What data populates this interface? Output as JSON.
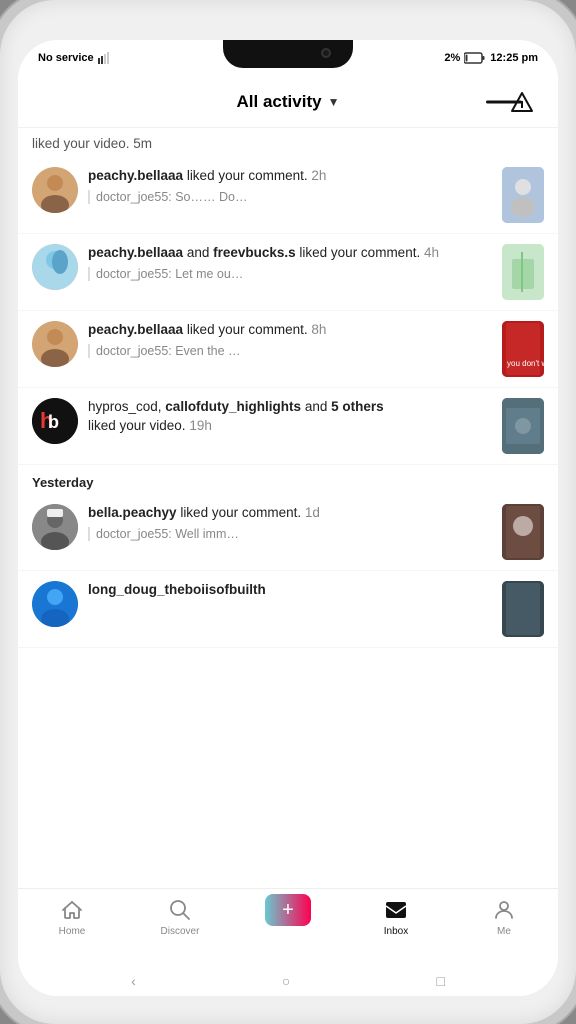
{
  "statusBar": {
    "carrier": "No service",
    "battery": "2%",
    "time": "12:25 pm"
  },
  "header": {
    "title": "All activity",
    "filterIconLabel": "filter"
  },
  "firstItem": {
    "text": "liked your video. 5m"
  },
  "notifications": [
    {
      "id": "n1",
      "username": "peachy.bellaaa",
      "action": "liked your comment.",
      "time": "2h",
      "comment": "doctor_joe55: So…… Do…",
      "avatarClass": "avatar-peachy",
      "thumbClass": "thumb-1"
    },
    {
      "id": "n2",
      "username": "peachy.bellaaa",
      "andUser": "freevbucks.s",
      "action": "liked your comment.",
      "time": "4h",
      "comment": "doctor_joe55: Let me ou…",
      "avatarClass": "avatar-peachy",
      "thumbClass": "thumb-2"
    },
    {
      "id": "n3",
      "username": "peachy.bellaaa",
      "action": "liked your comment.",
      "time": "8h",
      "comment": "doctor_joe55: Even the …",
      "avatarClass": "avatar-peachy",
      "thumbClass": "thumb-3"
    },
    {
      "id": "n4",
      "username": "hypros_cod,",
      "boldUser2": "callofduty_highlights",
      "andCount": "and 5 others",
      "action": "liked your video.",
      "time": "19h",
      "comment": "",
      "avatarClass": "avatar-hypros",
      "thumbClass": "thumb-4"
    }
  ],
  "sectionLabel": "Yesterday",
  "yesterdayNotifications": [
    {
      "id": "y1",
      "username": "bella.peachyy",
      "action": "liked your comment.",
      "time": "1d",
      "comment": "doctor_joe55: Well imm…",
      "avatarClass": "avatar-bella",
      "thumbClass": "thumb-5"
    },
    {
      "id": "y2",
      "username": "long_doug_theboiisofbuilth",
      "action": "",
      "time": "",
      "comment": "",
      "avatarClass": "avatar-long",
      "thumbClass": "thumb-6"
    }
  ],
  "bottomNav": {
    "items": [
      {
        "id": "home",
        "label": "Home",
        "icon": "home",
        "active": false
      },
      {
        "id": "discover",
        "label": "Discover",
        "icon": "search",
        "active": false
      },
      {
        "id": "create",
        "label": "",
        "icon": "plus",
        "active": false
      },
      {
        "id": "inbox",
        "label": "Inbox",
        "icon": "inbox",
        "active": true
      },
      {
        "id": "me",
        "label": "Me",
        "icon": "person",
        "active": false
      }
    ]
  },
  "gestureBar": {
    "back": "‹",
    "home": "○",
    "recent": "□"
  }
}
